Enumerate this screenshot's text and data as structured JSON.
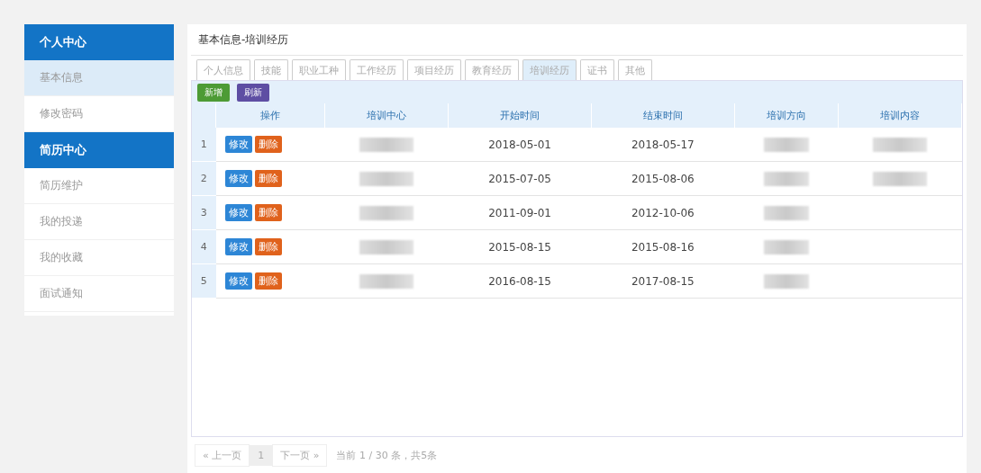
{
  "sidebar": {
    "groups": [
      {
        "title": "个人中心",
        "items": [
          {
            "label": "基本信息",
            "selected": true
          },
          {
            "label": "修改密码",
            "selected": false
          }
        ]
      },
      {
        "title": "简历中心",
        "items": [
          {
            "label": "简历维护",
            "selected": false
          },
          {
            "label": "我的投递",
            "selected": false
          },
          {
            "label": "我的收藏",
            "selected": false
          },
          {
            "label": "面试通知",
            "selected": false
          }
        ]
      }
    ]
  },
  "panel": {
    "title": "基本信息-培训经历",
    "tabs": [
      {
        "label": "个人信息",
        "selected": false
      },
      {
        "label": "技能",
        "selected": false
      },
      {
        "label": "职业工种",
        "selected": false
      },
      {
        "label": "工作经历",
        "selected": false
      },
      {
        "label": "项目经历",
        "selected": false
      },
      {
        "label": "教育经历",
        "selected": false
      },
      {
        "label": "培训经历",
        "selected": true
      },
      {
        "label": "证书",
        "selected": false
      },
      {
        "label": "其他",
        "selected": false
      }
    ],
    "toolbar": [
      {
        "label": "新增",
        "kind": "add"
      },
      {
        "label": "刷新",
        "kind": "refresh"
      }
    ],
    "table": {
      "columns": [
        "操作",
        "培训中心",
        "开始时间",
        "结束时间",
        "培训方向",
        "培训内容"
      ],
      "rows": [
        {
          "index": "1",
          "actions": [
            {
              "label": "修改",
              "kind": "edit"
            },
            {
              "label": "删除",
              "kind": "delete"
            }
          ],
          "center_redacted": true,
          "start": "2018-05-01",
          "end": "2018-05-17",
          "direction_redacted": true,
          "content_redacted": true
        },
        {
          "index": "2",
          "actions": [
            {
              "label": "修改",
              "kind": "edit"
            },
            {
              "label": "删除",
              "kind": "delete"
            }
          ],
          "center_redacted": true,
          "start": "2015-07-05",
          "end": "2015-08-06",
          "direction_redacted": true,
          "content_redacted": true
        },
        {
          "index": "3",
          "actions": [
            {
              "label": "修改",
              "kind": "edit"
            },
            {
              "label": "删除",
              "kind": "delete"
            }
          ],
          "center_redacted": true,
          "start": "2011-09-01",
          "end": "2012-10-06",
          "direction_redacted": true,
          "content_redacted": false
        },
        {
          "index": "4",
          "actions": [
            {
              "label": "修改",
              "kind": "edit"
            },
            {
              "label": "删除",
              "kind": "delete"
            }
          ],
          "center_redacted": true,
          "start": "2015-08-15",
          "end": "2015-08-16",
          "direction_redacted": true,
          "content_redacted": false
        },
        {
          "index": "5",
          "actions": [
            {
              "label": "修改",
              "kind": "edit"
            },
            {
              "label": "删除",
              "kind": "delete"
            }
          ],
          "center_redacted": true,
          "start": "2016-08-15",
          "end": "2017-08-15",
          "direction_redacted": true,
          "content_redacted": false
        }
      ]
    },
    "pagination": {
      "prev": "« 上一页",
      "pages": [
        {
          "label": "1",
          "selected": true
        }
      ],
      "next": "下一页 »",
      "summary": "当前 1 / 30 条，共5条"
    }
  }
}
